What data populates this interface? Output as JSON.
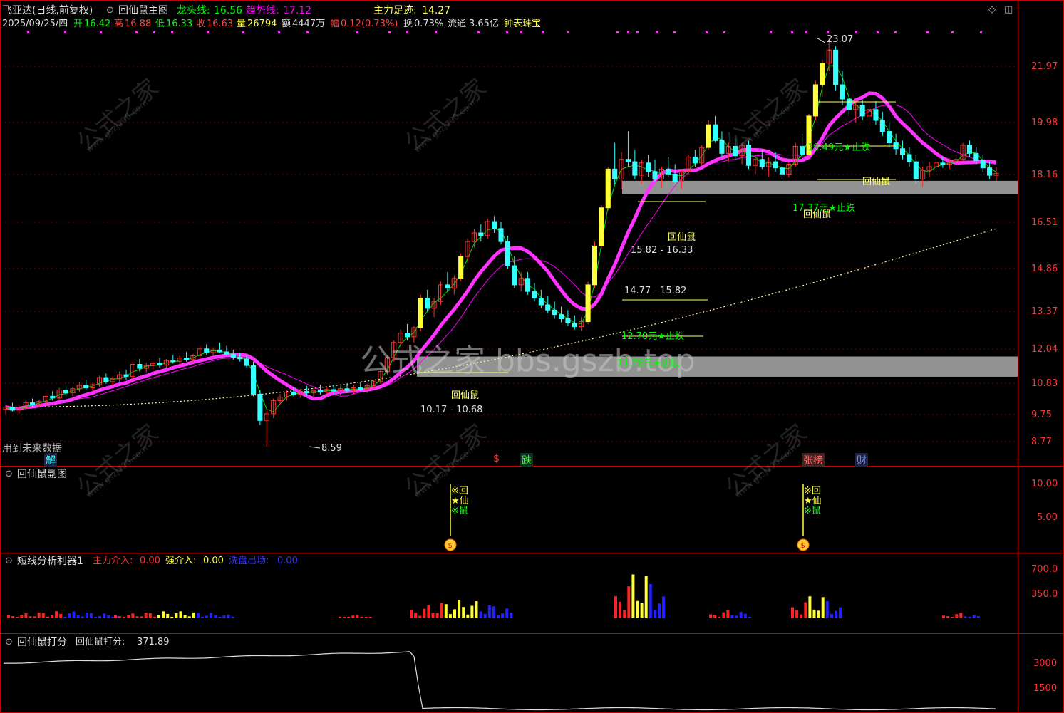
{
  "header": {
    "stock_name": "飞亚达(日线,前复权)",
    "main_indicator": "回仙鼠主图",
    "dragon_label": "龙头线:",
    "dragon_value": "16.56",
    "trend_label": "趋势线:",
    "trend_value": "17.12",
    "main_force_label": "主力足迹:",
    "main_force_value": "14.27"
  },
  "info_bar": {
    "date": "2025/09/25/四",
    "open_label": "开",
    "open": "16.42",
    "high_label": "高",
    "high": "16.88",
    "low_label": "低",
    "low": "16.33",
    "close_label": "收",
    "close": "16.63",
    "vol_label": "量",
    "vol": "26794",
    "amount_label": "额",
    "amount": "4447万",
    "change_label": "幅",
    "change": "0.12(0.73%)",
    "turnover_label": "换",
    "turnover": "0.73%",
    "float_label": "流通",
    "float": "3.65亿",
    "industry": "钟表珠宝"
  },
  "main_chart": {
    "future_note": "用到未来数据",
    "high_mark": "23.07",
    "low_mark": "8.59",
    "box_labels": [
      "15.82 - 16.33",
      "14.77 - 15.82",
      "10.17 - 10.68"
    ],
    "stop_labels": [
      "12.70元★止跌",
      "11.78元★止跌",
      "17.37元★止跌",
      "19.49元★止跌"
    ],
    "rat_labels": [
      "回仙鼠",
      "回仙鼠",
      "回仙鼠",
      "回仙鼠"
    ],
    "bottom_badges": [
      "解",
      "$",
      "跌",
      "张榜",
      "财"
    ],
    "center_watermark": "公式之家 bbs.gszb.top",
    "watermark": "公式之家",
    "watermark_url": "www.gszj100.com"
  },
  "sub1": {
    "title": "回仙鼠副图",
    "signal_text": [
      "※回",
      "★仙",
      "※鼠"
    ],
    "ticks": [
      "10.00",
      "5.00"
    ]
  },
  "sub2": {
    "title": "短线分析利器1",
    "main_in_label": "主力介入:",
    "main_in_value": "0.00",
    "strong_in_label": "强介入:",
    "strong_in_value": "0.00",
    "wash_out_label": "洗盘出场:",
    "wash_out_value": "0.00",
    "ticks": [
      "700.0",
      "350.0"
    ]
  },
  "sub3": {
    "title": "回仙鼠打分",
    "score_label": "回仙鼠打分:",
    "score_value": "371.89",
    "ticks": [
      "3000",
      "1500"
    ]
  },
  "price_axis": [
    "21.97",
    "19.98",
    "18.16",
    "16.51",
    "14.86",
    "13.37",
    "12.04",
    "10.83",
    "9.75",
    "8.77"
  ],
  "colors": {
    "up": "#ff3333",
    "down": "#33ffff",
    "dragon": "#00ff00",
    "trend": "#ff00ff",
    "footprint": "#ffff66",
    "box": "#a0a0a0"
  },
  "chart_data": {
    "type": "candlestick",
    "title": "飞亚达(日线,前复权)",
    "ylim": [
      8.4,
      23.6
    ],
    "ohlc": [
      [
        9.4,
        9.5,
        9.3,
        9.45
      ],
      [
        9.45,
        9.55,
        9.35,
        9.38
      ],
      [
        9.38,
        9.48,
        9.3,
        9.42
      ],
      [
        9.42,
        9.6,
        9.38,
        9.55
      ],
      [
        9.55,
        9.65,
        9.45,
        9.5
      ],
      [
        9.5,
        9.62,
        9.44,
        9.58
      ],
      [
        9.58,
        9.75,
        9.52,
        9.7
      ],
      [
        9.7,
        9.82,
        9.6,
        9.66
      ],
      [
        9.66,
        9.9,
        9.62,
        9.85
      ],
      [
        9.85,
        9.95,
        9.7,
        9.78
      ],
      [
        9.78,
        9.92,
        9.7,
        9.88
      ],
      [
        9.88,
        10.05,
        9.8,
        9.96
      ],
      [
        9.96,
        10.1,
        9.85,
        9.9
      ],
      [
        9.9,
        10.02,
        9.82,
        9.98
      ],
      [
        9.98,
        10.2,
        9.92,
        10.15
      ],
      [
        10.15,
        10.25,
        10.0,
        10.05
      ],
      [
        10.05,
        10.18,
        9.95,
        10.12
      ],
      [
        10.12,
        10.3,
        10.05,
        10.22
      ],
      [
        10.22,
        10.35,
        10.1,
        10.18
      ],
      [
        10.18,
        10.55,
        10.12,
        10.48
      ],
      [
        10.48,
        10.62,
        10.3,
        10.38
      ],
      [
        10.38,
        10.52,
        10.28,
        10.45
      ],
      [
        10.45,
        10.6,
        10.36,
        10.5
      ],
      [
        10.5,
        10.65,
        10.4,
        10.46
      ],
      [
        10.46,
        10.62,
        10.38,
        10.58
      ],
      [
        10.58,
        10.72,
        10.5,
        10.55
      ],
      [
        10.55,
        10.7,
        10.46,
        10.64
      ],
      [
        10.64,
        10.8,
        10.55,
        10.6
      ],
      [
        10.6,
        10.75,
        10.52,
        10.7
      ],
      [
        10.7,
        10.95,
        10.62,
        10.88
      ],
      [
        10.88,
        11.0,
        10.72,
        10.78
      ],
      [
        10.78,
        10.92,
        10.66,
        10.85
      ],
      [
        10.85,
        11.05,
        10.76,
        10.8
      ],
      [
        10.8,
        10.96,
        10.7,
        10.74
      ],
      [
        10.74,
        10.86,
        10.6,
        10.66
      ],
      [
        10.66,
        10.78,
        10.55,
        10.62
      ],
      [
        10.62,
        10.7,
        10.4,
        10.45
      ],
      [
        10.45,
        10.55,
        9.7,
        9.75
      ],
      [
        9.75,
        9.85,
        9.05,
        9.15
      ],
      [
        9.15,
        9.4,
        8.59,
        9.3
      ],
      [
        9.3,
        9.65,
        9.2,
        9.6
      ],
      [
        9.6,
        9.75,
        9.5,
        9.68
      ],
      [
        9.68,
        9.85,
        9.6,
        9.8
      ],
      [
        9.8,
        9.92,
        9.7,
        9.74
      ],
      [
        9.74,
        9.88,
        9.66,
        9.82
      ],
      [
        9.82,
        9.95,
        9.72,
        9.78
      ],
      [
        9.78,
        9.9,
        9.68,
        9.84
      ],
      [
        9.84,
        9.98,
        9.74,
        9.8
      ],
      [
        9.8,
        9.92,
        9.7,
        9.86
      ],
      [
        9.86,
        9.98,
        9.76,
        9.82
      ],
      [
        9.82,
        9.94,
        9.72,
        9.88
      ],
      [
        9.88,
        10.0,
        9.78,
        9.84
      ],
      [
        9.84,
        9.96,
        9.74,
        9.9
      ],
      [
        9.9,
        10.05,
        9.82,
        9.86
      ],
      [
        9.86,
        10.0,
        9.78,
        9.95
      ],
      [
        9.95,
        10.1,
        9.88,
        10.05
      ],
      [
        10.05,
        10.35,
        10.0,
        10.3
      ],
      [
        10.3,
        10.7,
        10.22,
        10.65
      ],
      [
        10.65,
        11.1,
        10.55,
        11.05
      ],
      [
        11.05,
        11.4,
        10.95,
        11.3
      ],
      [
        11.3,
        11.55,
        11.1,
        11.2
      ],
      [
        11.2,
        11.5,
        11.05,
        11.45
      ],
      [
        11.45,
        12.4,
        11.35,
        12.3
      ],
      [
        12.3,
        12.55,
        11.9,
        12.0
      ],
      [
        12.0,
        12.3,
        11.75,
        12.2
      ],
      [
        12.2,
        12.8,
        12.1,
        12.7
      ],
      [
        12.7,
        13.1,
        12.5,
        12.6
      ],
      [
        12.6,
        13.0,
        12.4,
        12.9
      ],
      [
        12.9,
        13.7,
        12.8,
        13.6
      ],
      [
        13.6,
        14.2,
        13.4,
        14.1
      ],
      [
        14.1,
        14.55,
        13.9,
        14.4
      ],
      [
        14.4,
        14.7,
        14.1,
        14.3
      ],
      [
        14.3,
        14.9,
        14.2,
        14.8
      ],
      [
        14.8,
        15.0,
        14.4,
        14.55
      ],
      [
        14.55,
        14.8,
        14.0,
        14.1
      ],
      [
        14.1,
        14.3,
        13.2,
        13.3
      ],
      [
        13.3,
        13.6,
        12.6,
        12.7
      ],
      [
        12.7,
        13.1,
        12.5,
        12.9
      ],
      [
        12.9,
        13.1,
        12.4,
        12.5
      ],
      [
        12.5,
        12.75,
        12.2,
        12.3
      ],
      [
        12.3,
        12.55,
        12.0,
        12.1
      ],
      [
        12.1,
        12.35,
        11.85,
        11.95
      ],
      [
        11.95,
        12.2,
        11.7,
        11.82
      ],
      [
        11.82,
        12.05,
        11.6,
        11.7
      ],
      [
        11.7,
        11.95,
        11.5,
        11.58
      ],
      [
        11.58,
        11.8,
        11.4,
        11.48
      ],
      [
        11.48,
        11.75,
        11.36,
        11.62
      ],
      [
        11.62,
        12.8,
        11.55,
        12.7
      ],
      [
        12.7,
        14.1,
        12.6,
        13.95
      ],
      [
        13.95,
        15.4,
        13.85,
        15.3
      ],
      [
        15.3,
        16.9,
        15.2,
        16.8
      ],
      [
        16.8,
        17.9,
        16.2,
        16.4
      ],
      [
        16.4,
        17.5,
        16.0,
        17.2
      ],
      [
        17.2,
        18.4,
        16.9,
        17.1
      ],
      [
        17.1,
        17.6,
        16.4,
        16.55
      ],
      [
        16.55,
        17.2,
        16.2,
        17.05
      ],
      [
        17.05,
        17.4,
        16.5,
        16.7
      ],
      [
        16.7,
        17.2,
        16.3,
        16.4
      ],
      [
        16.4,
        16.9,
        16.05,
        16.8
      ],
      [
        16.8,
        17.3,
        16.5,
        16.6
      ],
      [
        16.6,
        17.0,
        16.2,
        16.3
      ],
      [
        16.3,
        16.8,
        16.0,
        16.7
      ],
      [
        16.7,
        17.4,
        16.55,
        17.3
      ],
      [
        17.3,
        17.6,
        16.9,
        17.05
      ],
      [
        17.05,
        17.8,
        16.95,
        17.7
      ],
      [
        17.7,
        18.9,
        17.6,
        18.7
      ],
      [
        18.7,
        19.1,
        17.9,
        18.0
      ],
      [
        18.0,
        18.4,
        17.3,
        17.45
      ],
      [
        17.45,
        17.9,
        17.1,
        17.75
      ],
      [
        17.75,
        18.1,
        17.2,
        17.35
      ],
      [
        17.35,
        17.9,
        17.0,
        17.8
      ],
      [
        17.8,
        18.0,
        16.8,
        16.95
      ],
      [
        16.95,
        17.4,
        16.6,
        17.2
      ],
      [
        17.2,
        17.6,
        16.8,
        16.9
      ],
      [
        16.9,
        17.3,
        16.5,
        17.1
      ],
      [
        17.1,
        17.5,
        16.7,
        16.85
      ],
      [
        16.85,
        17.2,
        16.4,
        16.6
      ],
      [
        16.6,
        17.1,
        16.45,
        17.0
      ],
      [
        17.0,
        17.9,
        16.9,
        17.75
      ],
      [
        17.75,
        18.3,
        17.2,
        17.4
      ],
      [
        17.4,
        19.2,
        17.3,
        19.1
      ],
      [
        19.1,
        20.8,
        18.9,
        20.6
      ],
      [
        20.6,
        21.9,
        20.0,
        21.7
      ],
      [
        21.7,
        23.07,
        21.3,
        22.4
      ],
      [
        22.4,
        22.6,
        20.3,
        20.6
      ],
      [
        20.6,
        21.3,
        19.6,
        19.9
      ],
      [
        19.9,
        20.4,
        19.1,
        19.4
      ],
      [
        19.4,
        19.9,
        18.8,
        19.6
      ],
      [
        19.6,
        19.85,
        18.9,
        19.1
      ],
      [
        19.1,
        19.6,
        18.6,
        19.4
      ],
      [
        19.4,
        19.8,
        18.7,
        18.9
      ],
      [
        18.9,
        19.3,
        18.2,
        18.4
      ],
      [
        18.4,
        18.8,
        17.7,
        17.9
      ],
      [
        17.9,
        18.3,
        17.4,
        17.65
      ],
      [
        17.65,
        18.0,
        17.2,
        17.4
      ],
      [
        17.4,
        17.7,
        16.9,
        17.1
      ],
      [
        17.1,
        17.4,
        16.2,
        16.4
      ],
      [
        16.4,
        16.9,
        16.1,
        16.75
      ],
      [
        16.75,
        17.1,
        16.5,
        16.9
      ],
      [
        16.9,
        17.2,
        16.7,
        17.05
      ],
      [
        17.05,
        17.3,
        16.85,
        17.0
      ],
      [
        17.0,
        17.25,
        16.8,
        17.1
      ],
      [
        17.1,
        17.4,
        16.95,
        17.2
      ],
      [
        17.2,
        17.9,
        17.1,
        17.8
      ],
      [
        17.8,
        18.0,
        17.3,
        17.45
      ],
      [
        17.45,
        17.7,
        17.0,
        17.15
      ],
      [
        17.15,
        17.4,
        16.7,
        16.85
      ],
      [
        16.85,
        17.1,
        16.4,
        16.55
      ],
      [
        16.55,
        16.88,
        16.33,
        16.63
      ]
    ],
    "volume_bars": [],
    "score_series": [],
    "box_ranges": [
      [
        15.82,
        16.33
      ],
      [
        10.17,
        10.68
      ]
    ]
  }
}
